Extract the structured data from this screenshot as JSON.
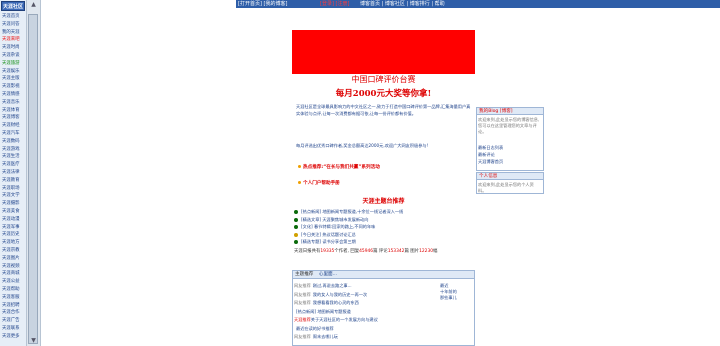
{
  "sidebar": {
    "logo": "天涯社区",
    "items": [
      {
        "label": "天涯首页",
        "color": "blue"
      },
      {
        "label": "天涯问答",
        "color": "blue"
      },
      {
        "label": "我的天涯",
        "color": "blue"
      },
      {
        "label": "天涯来吧",
        "color": "red"
      },
      {
        "label": "天涯时尚",
        "color": "blue"
      },
      {
        "label": "天涯杂谈",
        "color": "blue"
      },
      {
        "label": "天涯旅游",
        "color": "green"
      },
      {
        "label": "天涯娱乐",
        "color": "blue"
      },
      {
        "label": "天涯主版",
        "color": "blue"
      },
      {
        "label": "天涯影视",
        "color": "blue"
      },
      {
        "label": "天涯情感",
        "color": "blue"
      },
      {
        "label": "天涯音乐",
        "color": "blue"
      },
      {
        "label": "天涯体育",
        "color": "blue"
      },
      {
        "label": "天涯博客",
        "color": "blue"
      },
      {
        "label": "天涯财经",
        "color": "blue"
      },
      {
        "label": "天涯汽车",
        "color": "blue"
      },
      {
        "label": "天涯数码",
        "color": "blue"
      },
      {
        "label": "天涯游戏",
        "color": "blue"
      },
      {
        "label": "天涯生活",
        "color": "blue"
      },
      {
        "label": "天涯医疗",
        "color": "blue"
      },
      {
        "label": "天涯法律",
        "color": "blue"
      },
      {
        "label": "天涯教育",
        "color": "blue"
      },
      {
        "label": "天涯职场",
        "color": "blue"
      },
      {
        "label": "天涯文学",
        "color": "blue"
      },
      {
        "label": "天涯摄影",
        "color": "blue"
      },
      {
        "label": "天涯美食",
        "color": "blue"
      },
      {
        "label": "天涯动漫",
        "color": "blue"
      },
      {
        "label": "天涯军事",
        "color": "blue"
      },
      {
        "label": "天涯历史",
        "color": "blue"
      },
      {
        "label": "天涯地方",
        "color": "blue"
      },
      {
        "label": "天涯宗教",
        "color": "blue"
      },
      {
        "label": "天涯图片",
        "color": "blue"
      },
      {
        "label": "天涯视频",
        "color": "blue"
      },
      {
        "label": "天涯商城",
        "color": "blue"
      },
      {
        "label": "天涯公益",
        "color": "blue"
      },
      {
        "label": "天涯帮助",
        "color": "blue"
      },
      {
        "label": "天涯客服",
        "color": "blue"
      },
      {
        "label": "天涯招聘",
        "color": "blue"
      },
      {
        "label": "天涯合作",
        "color": "blue"
      },
      {
        "label": "天涯广告",
        "color": "blue"
      },
      {
        "label": "天涯联系",
        "color": "blue"
      },
      {
        "label": "天涯更多",
        "color": "blue"
      }
    ]
  },
  "topnav": {
    "left": "[打开首页] [我的博客]",
    "login": "[登录] [注册]",
    "right": "博客首页 | 博客社区 | 博客排行 | 帮助"
  },
  "headline": {
    "line1": "中国口碑评价台赛",
    "line2": "每月2000元大奖等你拿!"
  },
  "intro": {
    "p1": "天涯社区是全球最具影响力的中文社区之一,致力于打造中国口碑评价第一品牌,汇集海量用户真实体验与点评,让每一次消费都有据可依,让每一份评价都有价值。",
    "p2": "每月评选出优秀口碑作者,奖金总额高达2000元,欢迎广大网友积极参与!"
  },
  "promo_links": [
    "热点推荐:“在长与我们共赢”系列活动",
    "个人门户帮助手册"
  ],
  "section_title": "天涯主题台推荐",
  "news": [
    {
      "dot": "#0a6a0a",
      "text": "[热点新闻] 地图新闻专题报道,十余位一线记者深入一线"
    },
    {
      "dot": "#0a6a0a",
      "text": "[精选文章] 天涯聚焦城市发展新动向"
    },
    {
      "dot": "#0a6a0a",
      "text": "[文化] 春节特辑:回家的路上,不同的年味"
    },
    {
      "dot": "#d0a000",
      "text": "[今日关注] 热议话题讨论汇总"
    },
    {
      "dot": "#0a6a0a",
      "text": "[精选专题] 读书分享会第三期"
    }
  ],
  "stats": {
    "label1": "天涯日报共有",
    "v1": "19335",
    "label2": "个作者,",
    "label3": "回复",
    "v2": "45946",
    "label4": "篇",
    "label5": "评论",
    "v3": "153342",
    "label6": "篇",
    "label7": "图片",
    "v4": "12230",
    "label8": "幅"
  },
  "lower": {
    "head_label": "主题推荐",
    "head_link": "心里面...",
    "rows": [
      {
        "tag": "网友推荐",
        "text": "刚过,再说去路之事..."
      },
      {
        "tag": "网友推荐",
        "text": "我的女人与我的历史—再一次"
      },
      {
        "tag": "网友推荐",
        "text": "我想看看我的心灵的东西"
      },
      {
        "tag": "",
        "text": "[热点新闻] 地图新闻专题报道"
      },
      {
        "tag": "天涯推荐",
        "text": "关于天涯社区的一个发展方向与建议"
      },
      {
        "tag": "",
        "text": "最近在读的好书推荐"
      },
      {
        "tag": "网友推荐",
        "text": "周末去哪儿玩"
      }
    ],
    "side_note": "最近\n十年前的\n那些事儿"
  },
  "right_panel": {
    "head": "我的Blog [博客]",
    "text": "欢迎来到,此处显示您的博客信息,您可以在这里管理您的文章与评论。",
    "links": [
      "最新日志列表",
      "最新评论",
      "天涯博客首页"
    ]
  },
  "right_panel2": {
    "head": "个人信息",
    "text": "欢迎来到,此处显示您的个人资料。"
  },
  "colors": {
    "banner": "#ff0000",
    "nav": "#2e5ea8",
    "accent_red": "#dd0000",
    "link_blue": "#1a3f88"
  }
}
